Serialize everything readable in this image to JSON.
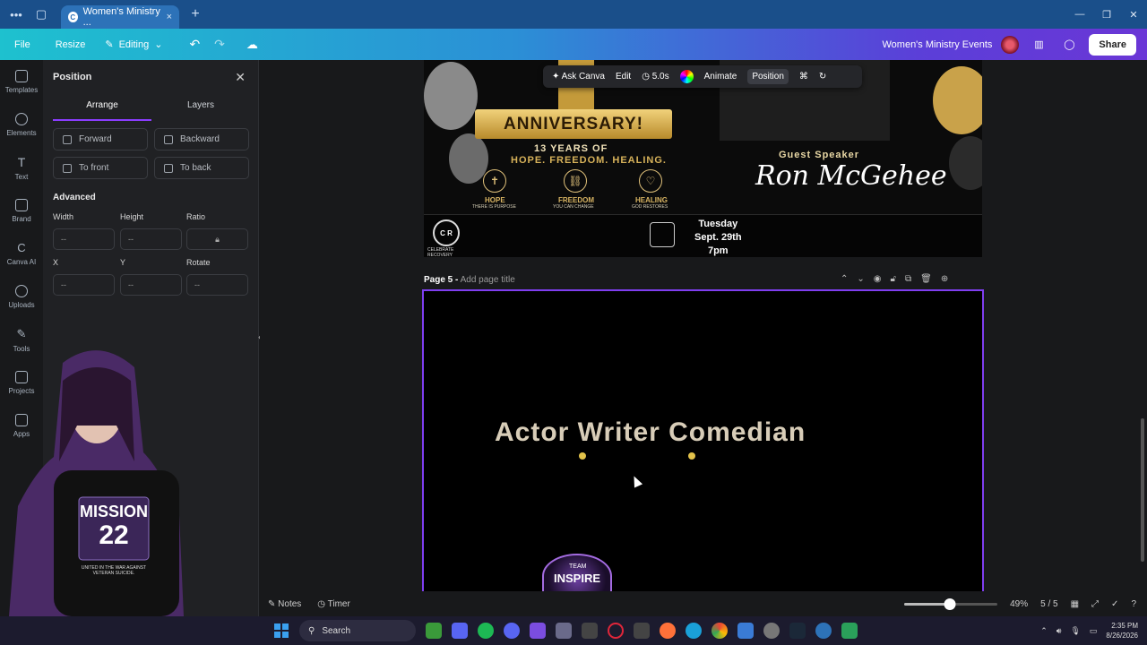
{
  "browser": {
    "tab_title": "Women's Ministry ...",
    "tab_close": "×",
    "new_tab": "+",
    "menu_dots": "•••",
    "window_controls": [
      "—",
      "❐",
      "✕"
    ]
  },
  "menubar": {
    "file": "File",
    "resize": "Resize",
    "editing": "Editing",
    "undo": "↶",
    "redo": "↷",
    "cloud": "☁",
    "project_title": "Women's Ministry Events",
    "share": "Share"
  },
  "rail": {
    "items": [
      "Templates",
      "Elements",
      "Text",
      "Brand",
      "Canva AI",
      "Uploads",
      "Tools",
      "Projects",
      "Apps"
    ]
  },
  "panel": {
    "title": "Position",
    "close": "✕",
    "tabs": [
      "Arrange",
      "Layers"
    ],
    "buttons": [
      "Forward",
      "Backward",
      "To front",
      "To back"
    ],
    "advanced": "Advanced",
    "labels": {
      "width": "Width",
      "height": "Height",
      "ratio": "Ratio",
      "x": "X",
      "y": "Y",
      "rotate": "Rotate"
    },
    "values": {
      "width": "--",
      "height": "--",
      "x": "--",
      "y": "--",
      "rotate": "--"
    },
    "collapse": "‹"
  },
  "character": {
    "shirt_line1": "MISSION",
    "shirt_line2": "22",
    "shirt_small": "UNITED IN THE WAR AGAINST VETERAN SUICIDE."
  },
  "banner": {
    "ribbon": "ANNIVERSARY!",
    "line1": "13 YEARS OF",
    "line2": "HOPE. FREEDOM. HEALING.",
    "pillars": [
      {
        "title": "HOPE",
        "sub": "THERE IS PURPOSE",
        "glyph": "✝"
      },
      {
        "title": "FREEDOM",
        "sub": "YOU CAN CHANGE",
        "glyph": "⛓"
      },
      {
        "title": "HEALING",
        "sub": "GOD RESTORES",
        "glyph": "♡"
      }
    ],
    "guest_label": "Guest Speaker",
    "guest_name": "Ron McGehee",
    "cr_mark": "C R",
    "cr_text": "CELEBRATE RECOVERY",
    "date_line1": "Tuesday",
    "date_line2": "Sept. 29th",
    "date_line3": "7pm"
  },
  "floating_toolbar": {
    "ask": "Ask Canva",
    "edit": "Edit",
    "duration": "5.0s",
    "animate": "Animate",
    "position": "Position"
  },
  "page": {
    "label_bold": "Page 5 -",
    "label_placeholder": "Add page title",
    "headline": "Actor  Writer  Comedian",
    "logo_text": "INSPIRE",
    "logo_small": "TEAM"
  },
  "bottombar": {
    "notes": "Notes",
    "timer": "Timer",
    "zoom": "49%",
    "zoom_value": 49,
    "pages": "5 / 5"
  },
  "taskbar": {
    "search": "Search",
    "time": "2:35 PM",
    "date": "8/26/2026"
  },
  "colors": {
    "accent": "#8b3dff",
    "menubar_start": "#1ec1cf",
    "menubar_end": "#6a36d6",
    "gold": "#d8b463"
  }
}
